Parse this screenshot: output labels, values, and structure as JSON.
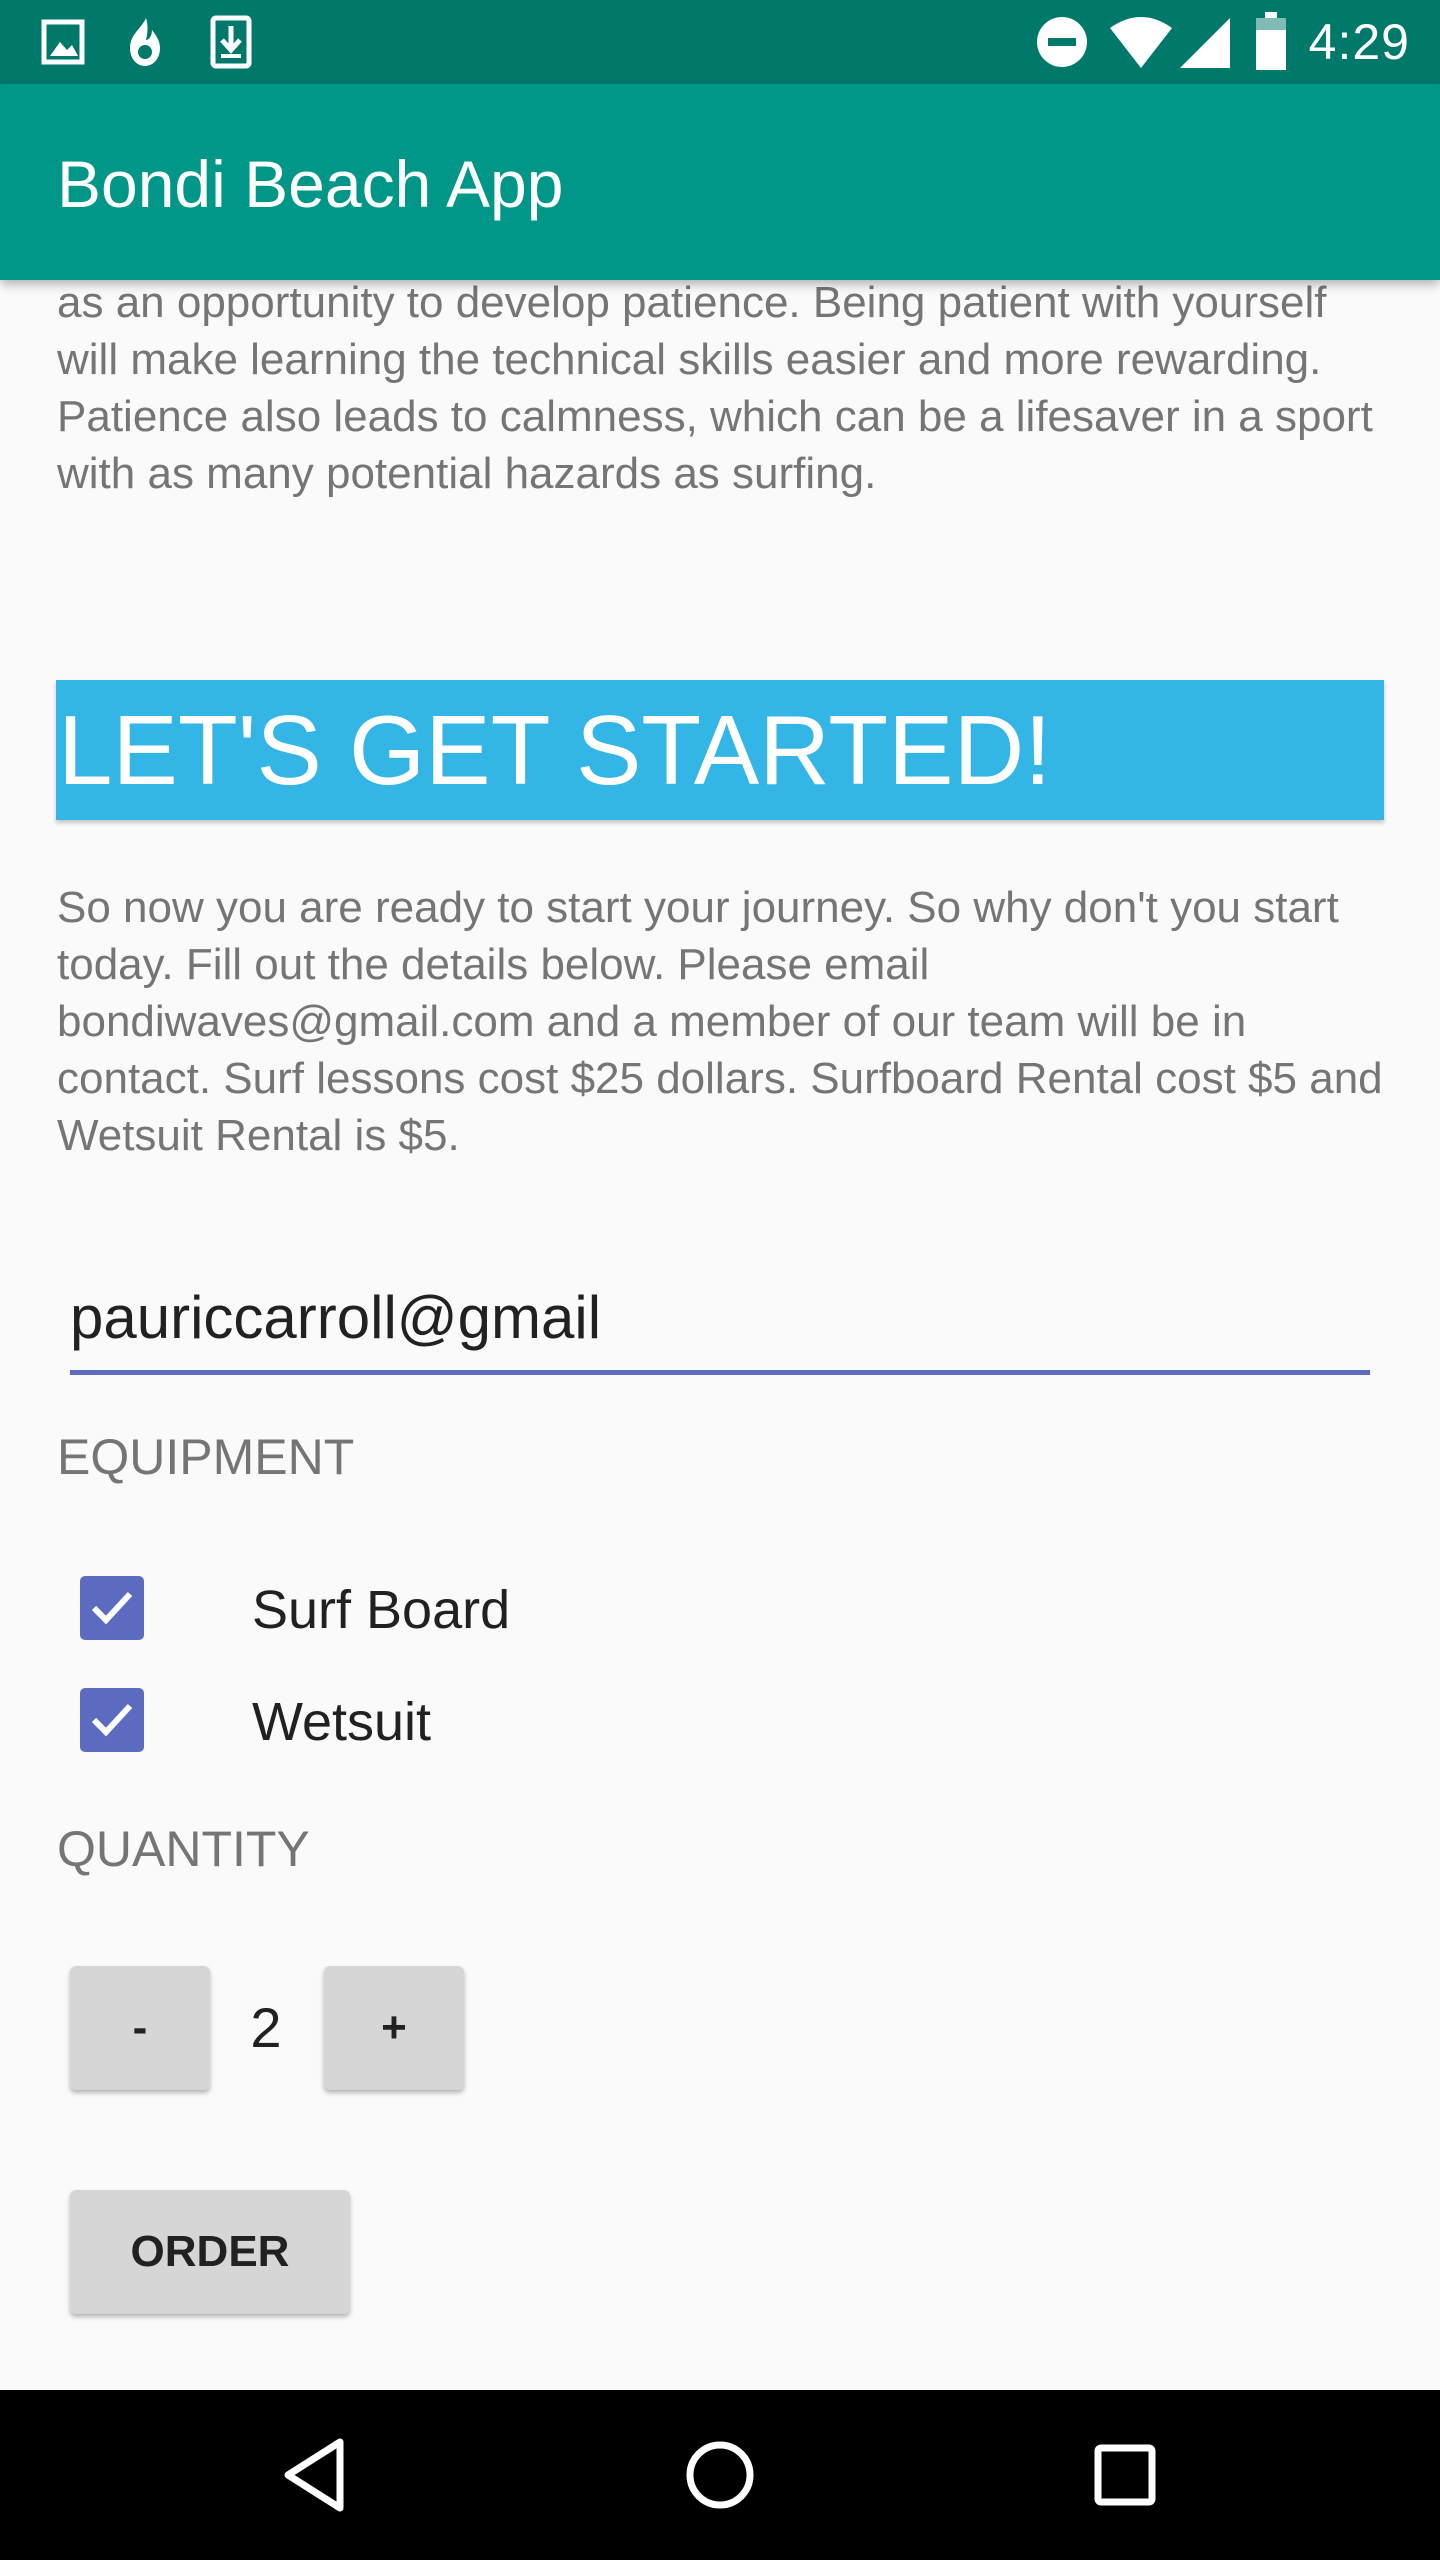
{
  "status_bar": {
    "time": "4:29",
    "left_icons": [
      "image-icon",
      "fire-icon",
      "download-icon"
    ],
    "right_icons": [
      "do-not-disturb-icon",
      "wifi-icon",
      "cell-signal-icon",
      "battery-icon"
    ]
  },
  "app_bar": {
    "title": "Bondi Beach App",
    "color": "#009688"
  },
  "content": {
    "intro_text": "as an opportunity to develop patience. Being patient with yourself will make learning the technical skills easier and more rewarding. Patience also leads to calmness, which can be a lifesaver in a sport with as many potential hazards as surfing.",
    "banner_heading": "LET'S GET STARTED!",
    "banner_color": "#33b5e5",
    "body_text": "So now you are ready to start your journey. So why don't you start today. Fill out the details below. Please email bondiwaves@gmail.com and a member of our team will be in contact. Surf lessons cost $25 dollars. Surfboard Rental cost $5 and Wetsuit Rental is $5.",
    "email_value": "pauriccarroll@gmail",
    "equipment_label": "EQUIPMENT",
    "equipment_options": [
      {
        "label": "Surf Board",
        "checked": true
      },
      {
        "label": "Wetsuit",
        "checked": true
      }
    ],
    "quantity_label": "QUANTITY",
    "decrement_label": "-",
    "quantity_value": "2",
    "increment_label": "+",
    "order_label": "ORDER",
    "accent_color": "#5c6bc0"
  },
  "nav_bar": {
    "buttons": [
      "back-icon",
      "home-icon",
      "recents-icon"
    ]
  }
}
